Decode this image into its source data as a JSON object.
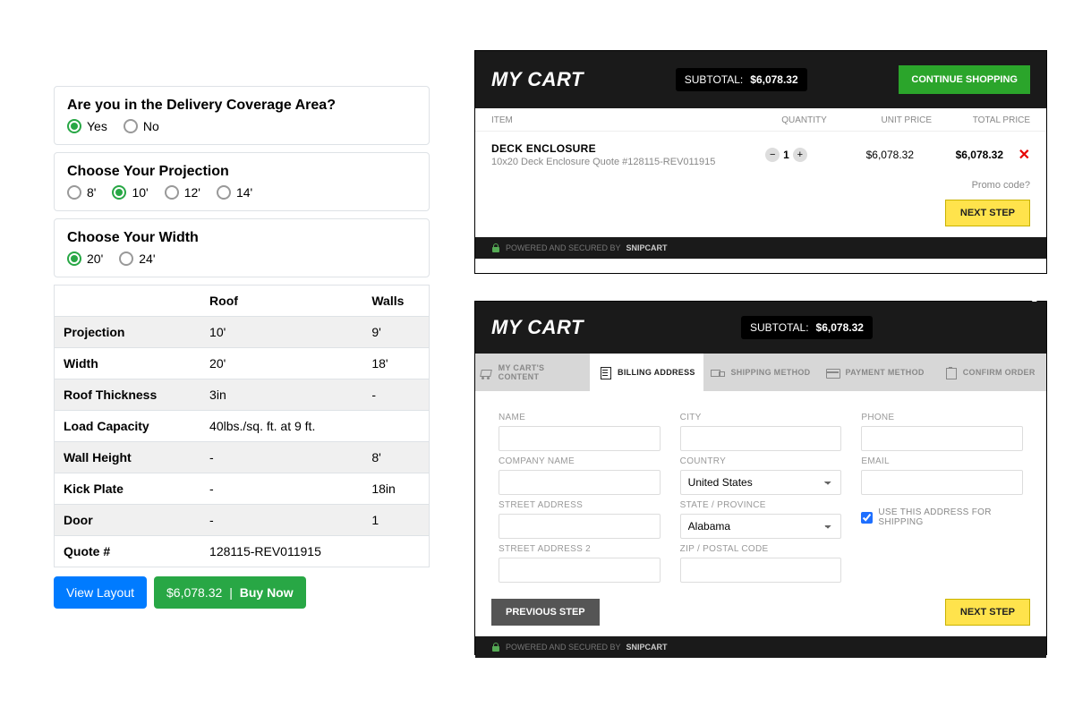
{
  "config": {
    "delivery": {
      "title": "Are you in the Delivery Coverage Area?",
      "options": [
        "Yes",
        "No"
      ],
      "selected": "Yes"
    },
    "projection": {
      "title": "Choose Your Projection",
      "options": [
        "8'",
        "10'",
        "12'",
        "14'"
      ],
      "selected": "10'"
    },
    "width": {
      "title": "Choose Your Width",
      "options": [
        "20'",
        "24'"
      ],
      "selected": "20'"
    }
  },
  "spec_table": {
    "headers": [
      "",
      "Roof",
      "Walls"
    ],
    "rows": [
      {
        "label": "Projection",
        "roof": "10'",
        "walls": "9'"
      },
      {
        "label": "Width",
        "roof": "20'",
        "walls": "18'"
      },
      {
        "label": "Roof Thickness",
        "roof": "3in",
        "walls": "-"
      },
      {
        "label": "Load Capacity",
        "roof": " 40lbs./sq. ft. at 9 ft.",
        "walls": ""
      },
      {
        "label": "Wall Height",
        "roof": "-",
        "walls": "8'"
      },
      {
        "label": "Kick Plate",
        "roof": "-",
        "walls": "18in"
      },
      {
        "label": "Door",
        "roof": "-",
        "walls": "1"
      },
      {
        "label": "Quote #",
        "roof": "128115-REV011915",
        "walls": ""
      }
    ]
  },
  "buttons": {
    "view_layout": "View Layout",
    "buy_price": "$6,078.32",
    "buy_divider": "|",
    "buy_label": "Buy Now"
  },
  "cart_top": {
    "title": "MY CART",
    "subtotal_label": "SUBTOTAL:",
    "subtotal_value": "$6,078.32",
    "continue_label": "CONTINUE SHOPPING",
    "cols": {
      "item": "ITEM",
      "qty": "QUANTITY",
      "unit": "UNIT PRICE",
      "total": "TOTAL PRICE"
    },
    "line": {
      "name": "DECK ENCLOSURE",
      "desc": "10x20 Deck Enclosure Quote #128115-REV011915",
      "qty": "1",
      "unit_price": "$6,078.32",
      "total_price": "$6,078.32"
    },
    "promo": "Promo code?",
    "next": "NEXT STEP",
    "footer_prefix": "POWERED AND SECURED BY",
    "footer_brand": "SNIPCART"
  },
  "cart_bottom": {
    "title": "MY CART",
    "subtotal_label": "SUBTOTAL:",
    "subtotal_value": "$6,078.32",
    "steps": [
      {
        "label": "MY CART'S CONTENT",
        "icon": "cart"
      },
      {
        "label": "BILLING ADDRESS",
        "icon": "receipt",
        "active": true
      },
      {
        "label": "SHIPPING METHOD",
        "icon": "truck"
      },
      {
        "label": "PAYMENT METHOD",
        "icon": "card"
      },
      {
        "label": "CONFIRM ORDER",
        "icon": "clipboard"
      }
    ],
    "form": {
      "name": "NAME",
      "company": "COMPANY NAME",
      "street1": "STREET ADDRESS",
      "street2": "STREET ADDRESS 2",
      "city": "CITY",
      "country_label": "COUNTRY",
      "country_value": "United States",
      "state_label": "STATE / PROVINCE",
      "state_value": "Alabama",
      "zip": "ZIP / POSTAL CODE",
      "phone": "PHONE",
      "email": "EMAIL",
      "use_for_shipping": "USE THIS ADDRESS FOR SHIPPING"
    },
    "prev": "PREVIOUS STEP",
    "next": "NEXT STEP",
    "footer_prefix": "POWERED AND SECURED BY",
    "footer_brand": "SNIPCART"
  }
}
